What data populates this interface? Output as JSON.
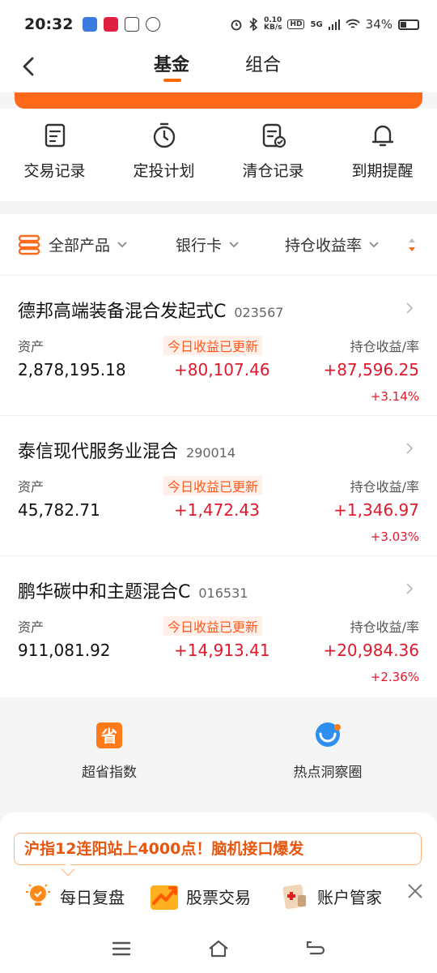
{
  "status": {
    "time": "20:32",
    "net_speed_value": "0.10",
    "net_speed_unit": "KB/s",
    "hd": "HD",
    "network": "5G",
    "battery": "34%"
  },
  "header": {
    "tabs": [
      "基金",
      "组合"
    ],
    "active_tab": "基金"
  },
  "quick_actions": [
    "交易记录",
    "定投计划",
    "清仓记录",
    "到期提醒"
  ],
  "filters": {
    "all_products": "全部产品",
    "bank_card": "银行卡",
    "hold_rate": "持仓收益率"
  },
  "labels": {
    "asset": "资产",
    "today_updated": "今日收益已更新",
    "hold_income": "持仓收益/率"
  },
  "funds": [
    {
      "name": "德邦高端装备混合发起式C",
      "code": "023567",
      "asset": "2,878,195.18",
      "today": "+80,107.46",
      "hold": "+87,596.25",
      "rate": "+3.14%"
    },
    {
      "name": "泰信现代服务业混合",
      "code": "290014",
      "asset": "45,782.71",
      "today": "+1,472.43",
      "hold": "+1,346.97",
      "rate": "+3.03%"
    },
    {
      "name": "鹏华碳中和主题混合C",
      "code": "016531",
      "asset": "911,081.92",
      "today": "+14,913.41",
      "hold": "+20,984.36",
      "rate": "+2.36%"
    }
  ],
  "features": [
    {
      "label": "超省指数",
      "icon_char": "省"
    },
    {
      "label": "热点洞察圈"
    }
  ],
  "promo": "沪指12连阳站上4000点！脑机接口爆发",
  "shortcuts": [
    "每日复盘",
    "股票交易",
    "账户管家"
  ],
  "colors": {
    "accent": "#ff6a00",
    "gain": "#e0182b"
  }
}
